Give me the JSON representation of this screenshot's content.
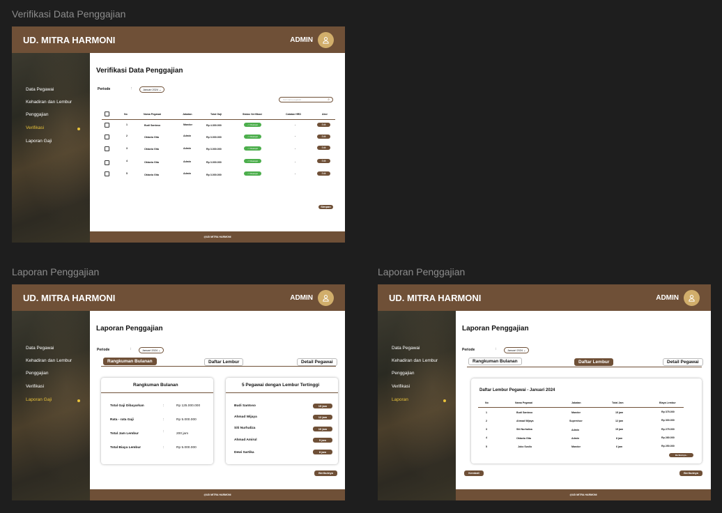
{
  "brand": "UD. MITRA HARMONI",
  "admin_label": "ADMIN",
  "footer": "@UD MITRA HARMONI",
  "frames": [
    {
      "frame_title": "Verifikasi Data Penggajian",
      "nav": [
        "Data Pegawai",
        "Kehadiran dan Lembur",
        "Penggajian",
        "Verifikasi",
        "Laporan Gaji"
      ],
      "page_title": "Verifikasi Data Penggajian",
      "periode_label": "Periode",
      "periode_value": "Januari 2024",
      "search_placeholder": "Cari nama pegawai...",
      "columns": [
        "No",
        "Nama Pegawai",
        "Jabatan",
        "Total Gaji",
        "Status Verifikasi",
        "Catatan HRD",
        "Aksi"
      ],
      "rows": [
        {
          "no": "1",
          "nama": "Budi Santoso",
          "jabatan": "Mandor",
          "gaji": "Rp 4.300.000",
          "status": "✓ Disetujui",
          "catatan": "-",
          "aksi": "Edit"
        },
        {
          "no": "2",
          "nama": "Oktavia Gita",
          "jabatan": "Admin",
          "gaji": "Rp 3.000.000",
          "status": "✓ Disetujui",
          "catatan": "-",
          "aksi": "Edit"
        },
        {
          "no": "3",
          "nama": "Oktavia Gita",
          "jabatan": "Admin",
          "gaji": "Rp 3.000.000",
          "status": "✓ Disetujui",
          "catatan": "-",
          "aksi": "Edit"
        },
        {
          "no": "4",
          "nama": "Oktavia Gita",
          "jabatan": "Admin",
          "gaji": "Rp 3.000.000",
          "status": "✓ Disetujui",
          "catatan": "-",
          "aksi": "Edit"
        },
        {
          "no": "5",
          "nama": "Oktavia Gita",
          "jabatan": "Admin",
          "gaji": "Rp 3.000.000",
          "status": "✓ Disetujui",
          "catatan": "-",
          "aksi": "Edit"
        }
      ],
      "simpan": "Simpan"
    },
    {
      "frame_title": "Laporan Penggajian",
      "nav": [
        "Data Pegawai",
        "Kehadiran dan Lembur",
        "Penggajian",
        "Verifikasi",
        "Laporan Gaji"
      ],
      "page_title": "Laporan Penggajian",
      "periode_label": "Periode",
      "periode_value": "Januari 2024",
      "tabs": [
        "Rangkuman Bulanan",
        "Daftar Lembur",
        "Detail Pegawai"
      ],
      "summary_title": "Rangkuman Bulanan",
      "summary": [
        {
          "label": "Total Gaji Dibayarkan",
          "value": "Rp 125.000.000"
        },
        {
          "label": "Rata - rata Gaji",
          "value": "Rp 5.000.000"
        },
        {
          "label": "Total Jam Lembur",
          "value": "200 jam"
        },
        {
          "label": "Total Biaya Lembur",
          "value": "Rp 5.000.000"
        }
      ],
      "top_title": "5 Pegawai dengan Lembur Tertinggi",
      "top": [
        {
          "name": "Budi Santoso",
          "jam": "15 jam"
        },
        {
          "name": "Ahmad Wijaya",
          "jam": "12 jam"
        },
        {
          "name": "Siti Nurhaliza",
          "jam": "10 jam"
        },
        {
          "name": "Ahmad Amirul",
          "jam": "9 jam"
        },
        {
          "name": "Dewi Sartika",
          "jam": "8 jam"
        }
      ],
      "next": "Berikutnya"
    },
    {
      "frame_title": "Laporan Penggajian",
      "nav": [
        "Data Pegawai",
        "Kehadiran dan Lembur",
        "Penggajian",
        "Verifikasi",
        "Laporan"
      ],
      "page_title": "Laporan Penggajian",
      "periode_label": "Periode",
      "periode_value": "Januari 2024",
      "tabs": [
        "Rangkuman Bulanan",
        "Daftar Lembur",
        "Detail Pegawai"
      ],
      "list_title": "Daftar Lembur Pegawai  - Januari 2024",
      "columns": [
        "No",
        "Nama Pegawai",
        "Jabatan",
        "Total Jam",
        "Biaya Lembur"
      ],
      "rows": [
        {
          "no": "1",
          "nama": "Budi Santoso",
          "jabatan": "Mandor",
          "jam": "15 jam",
          "biaya": "Rp 375.000"
        },
        {
          "no": "2",
          "nama": "Ahmad Wijaya",
          "jabatan": "Supervisor",
          "jam": "12 jam",
          "biaya": "Rp 300.000"
        },
        {
          "no": "3",
          "nama": "Siti Nurhaliza",
          "jabatan": "Admin",
          "jam": "15 jam",
          "biaya": "Rp 275.000"
        },
        {
          "no": "4",
          "nama": "Oktavia Gita",
          "jabatan": "Admin",
          "jam": "8 jam",
          "biaya": "Rp 280.000"
        },
        {
          "no": "5",
          "nama": "Joko Susilo",
          "jabatan": "Mandor",
          "jam": "6 jam",
          "biaya": "Rp 250.000"
        }
      ],
      "inner_next": "Berikutnya",
      "back": "Kembali",
      "next": "Berikutnya"
    }
  ]
}
